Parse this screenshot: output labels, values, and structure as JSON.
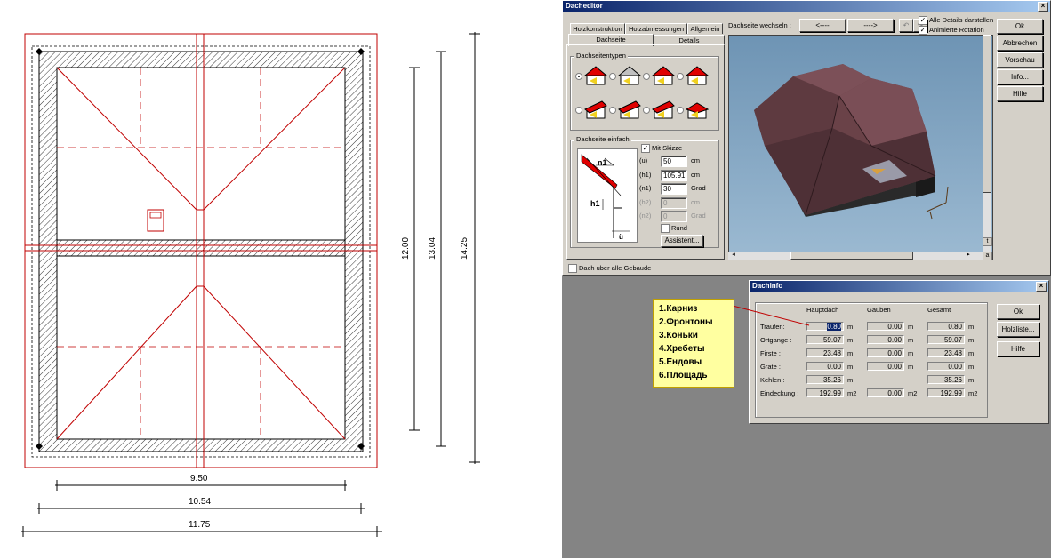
{
  "plan": {
    "dims_horizontal": [
      "9.50",
      "10.54",
      "11.75"
    ],
    "dims_vertical": [
      "12.00",
      "13.04",
      "14.25"
    ]
  },
  "dacheditor": {
    "title": "Dacheditor",
    "close": "×",
    "tabs_row1": [
      "Holzkonstruktion",
      "Holzabmessungen",
      "Allgemein"
    ],
    "tabs_row2": [
      "Dachseite",
      "Details"
    ],
    "dachseite_wechseln": "Dachseite wechseln :",
    "prev_button": "<----",
    "next_button": "---->",
    "chk_alle_details": "Alle Details darstellen",
    "chk_animierte": "Animierte Rotation",
    "buttons": [
      "Ok",
      "Abbrechen",
      "Vorschau",
      "Info...",
      "Hilfe"
    ],
    "group_typen": "Dachseitentypen",
    "group_einfach": "Dachseite einfach",
    "mit_skizze": "Mit Skizze",
    "sketch_n1": "n1",
    "sketch_h1": "h1",
    "sketch_u": "ü",
    "params": [
      {
        "label": "(u)",
        "value": "50",
        "unit": "cm",
        "disabled": false
      },
      {
        "label": "(h1)",
        "value": "105.91",
        "unit": "cm",
        "disabled": false
      },
      {
        "label": "(n1)",
        "value": "30",
        "unit": "Grad",
        "disabled": false
      },
      {
        "label": "(h2)",
        "value": "0",
        "unit": "cm",
        "disabled": true
      },
      {
        "label": "(n2)",
        "value": "0",
        "unit": "Grad",
        "disabled": true
      }
    ],
    "rund": "Rund",
    "assistent": "Assistent...",
    "dach_uber_alle": "Dach uber alle Gebaude",
    "scroll_t": "t",
    "scroll_a": "a"
  },
  "dachinfo": {
    "title": "Dachinfo",
    "close": "×",
    "col_headers": [
      "Hauptdach",
      "Gauben",
      "Gesamt"
    ],
    "rows": [
      {
        "label": "Traufen:",
        "haupt": "0.80",
        "haupt_unit": "m",
        "gauben": "0.00",
        "gauben_unit": "m",
        "gesamt": "0.80",
        "gesamt_unit": "m"
      },
      {
        "label": "Ortgange :",
        "haupt": "59.07",
        "haupt_unit": "m",
        "gauben": "0.00",
        "gauben_unit": "m",
        "gesamt": "59.07",
        "gesamt_unit": "m"
      },
      {
        "label": "Firste :",
        "haupt": "23.48",
        "haupt_unit": "m",
        "gauben": "0.00",
        "gauben_unit": "m",
        "gesamt": "23.48",
        "gesamt_unit": "m"
      },
      {
        "label": "Grate :",
        "haupt": "0.00",
        "haupt_unit": "m",
        "gauben": "0.00",
        "gauben_unit": "m",
        "gesamt": "0.00",
        "gesamt_unit": "m"
      },
      {
        "label": "Kehlen :",
        "haupt": "35.26",
        "haupt_unit": "m",
        "gauben": "",
        "gauben_unit": "",
        "gesamt": "35.26",
        "gesamt_unit": "m"
      },
      {
        "label": "Eindeckung :",
        "haupt": "192.99",
        "haupt_unit": "m2",
        "gauben": "0.00",
        "gauben_unit": "m2",
        "gesamt": "192.99",
        "gesamt_unit": "m2"
      }
    ],
    "buttons": [
      "Ok",
      "Holzliste...",
      "Hilfe"
    ]
  },
  "note": {
    "lines": [
      "1.Карниз",
      "2.Фронтоны",
      "3.Коньки",
      "4.Хребеты",
      "5.Ендовы",
      "6.Площадь"
    ]
  }
}
